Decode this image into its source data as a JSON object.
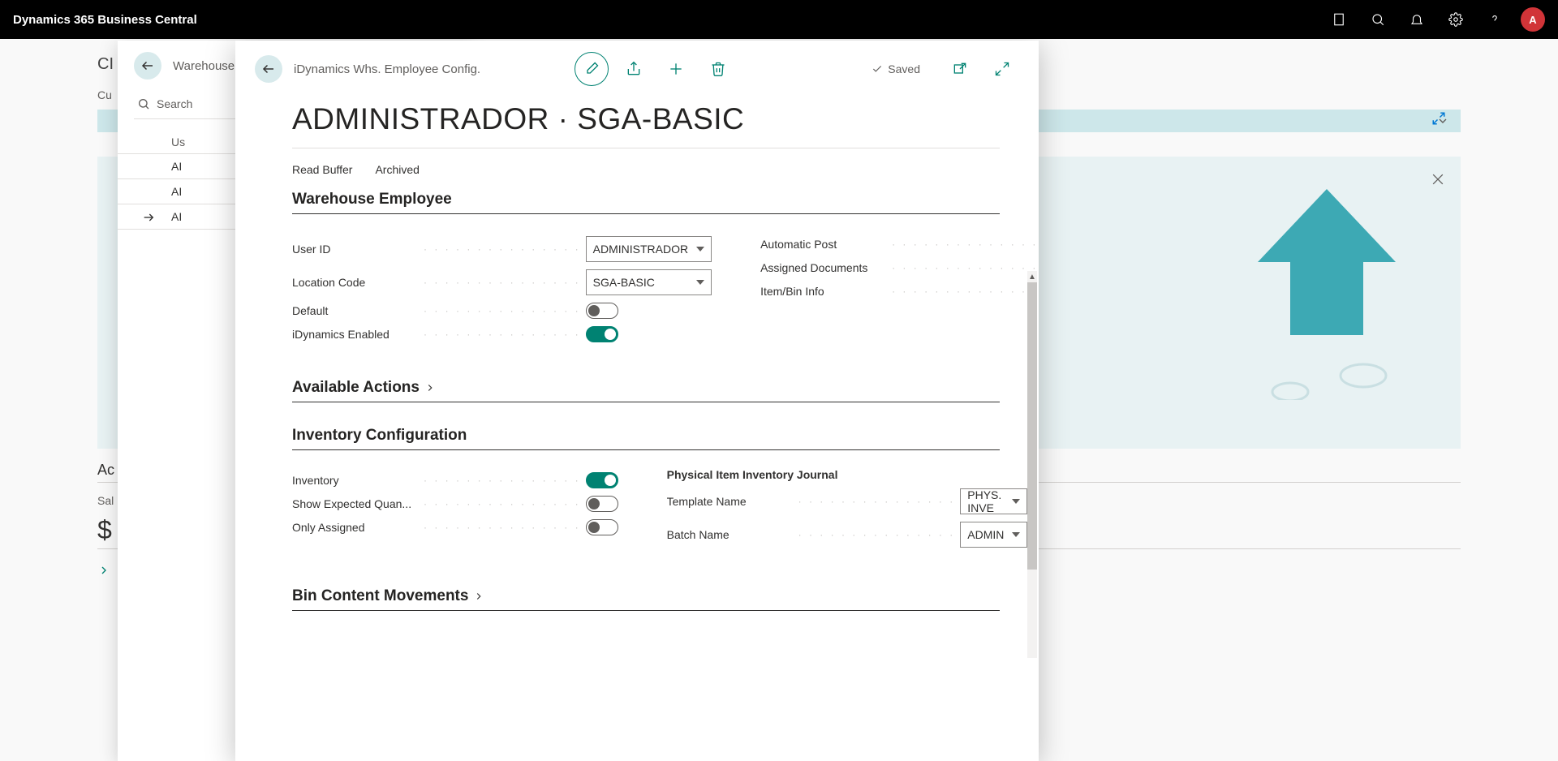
{
  "titlebar": {
    "product": "Dynamics 365 Business Central",
    "avatar_initial": "A"
  },
  "background": {
    "corner": "CI",
    "tab": "Cu",
    "actions": "Ac",
    "sales": "Sal",
    "dollar": "$"
  },
  "panel2": {
    "breadcrumb": "Warehouse",
    "search_placeholder": "Search",
    "column_header": "Us",
    "rows": [
      "AI",
      "AI",
      "AI"
    ]
  },
  "panel3": {
    "breadcrumb": "iDynamics Whs. Employee Config.",
    "saved_label": "Saved",
    "title": "ADMINISTRADOR · SGA-BASIC",
    "tabs": {
      "read_buffer": "Read Buffer",
      "archived": "Archived"
    },
    "sections": {
      "warehouse_employee": {
        "title": "Warehouse Employee",
        "user_id": {
          "label": "User ID",
          "value": "ADMINISTRADOR"
        },
        "location_code": {
          "label": "Location Code",
          "value": "SGA-BASIC"
        },
        "default": {
          "label": "Default",
          "value": false
        },
        "idynamics_enabled": {
          "label": "iDynamics Enabled",
          "value": true
        },
        "automatic_post": {
          "label": "Automatic Post",
          "value": true
        },
        "assigned_documents": {
          "label": "Assigned Documents",
          "value": true
        },
        "item_bin_info": {
          "label": "Item/Bin Info",
          "value": true
        }
      },
      "available_actions": {
        "title": "Available Actions"
      },
      "inventory_config": {
        "title": "Inventory Configuration",
        "inventory": {
          "label": "Inventory",
          "value": true
        },
        "show_expected": {
          "label": "Show Expected Quan...",
          "value": false
        },
        "only_assigned": {
          "label": "Only Assigned",
          "value": false
        },
        "journal_heading": "Physical Item Inventory Journal",
        "template_name": {
          "label": "Template Name",
          "value": "PHYS. INVE"
        },
        "batch_name": {
          "label": "Batch Name",
          "value": "ADMIN"
        }
      },
      "bin_content": {
        "title": "Bin Content Movements"
      }
    }
  },
  "dots": "· · · · · · · · · · · · · · ·"
}
